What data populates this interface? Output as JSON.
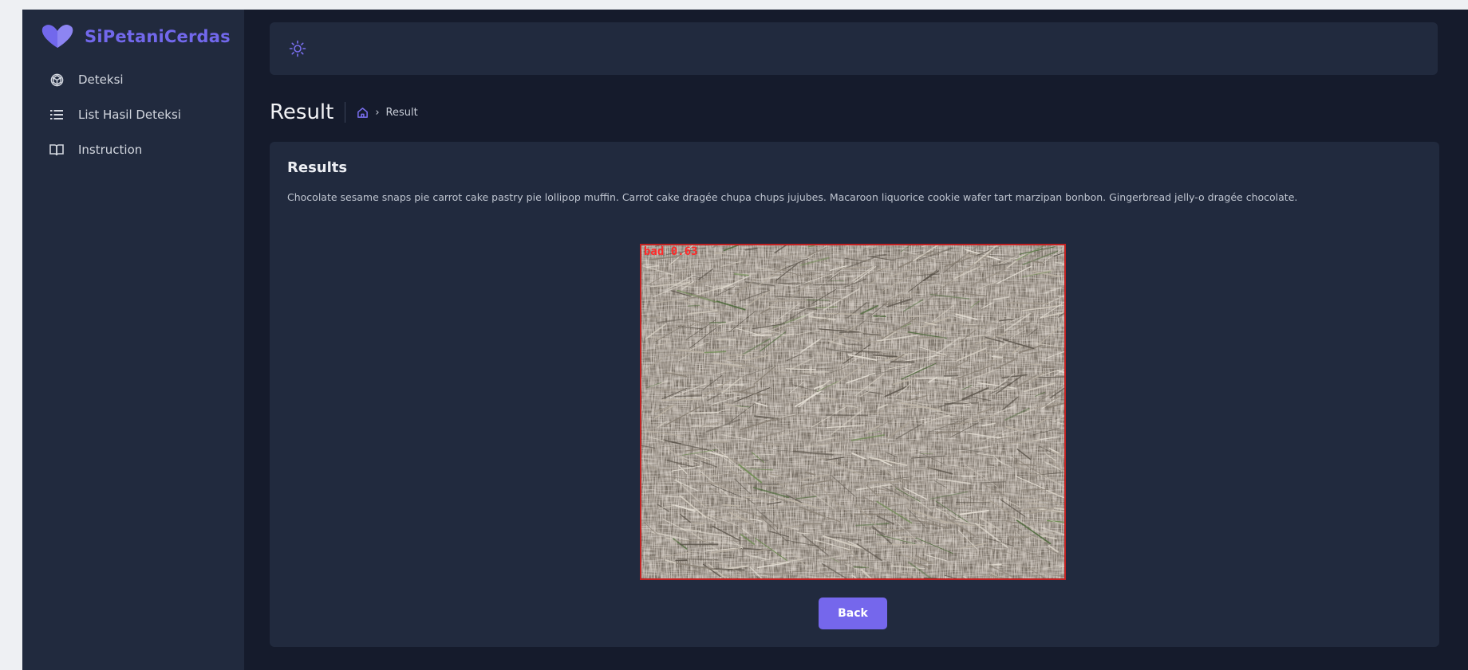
{
  "brand": {
    "name": "SiPetaniCerdas",
    "logo_icon": "heart-logo-icon",
    "color": "#7268ec"
  },
  "sidebar": {
    "items": [
      {
        "label": "Deteksi",
        "icon": "cube-icon"
      },
      {
        "label": "List Hasil Deteksi",
        "icon": "list-icon"
      },
      {
        "label": "Instruction",
        "icon": "book-icon"
      }
    ]
  },
  "topbar": {
    "theme_toggle_icon": "sun-icon"
  },
  "page": {
    "title": "Result",
    "breadcrumb": {
      "home_icon": "home-icon",
      "separator": "›",
      "current": "Result"
    }
  },
  "results": {
    "title": "Results",
    "description": "Chocolate sesame snaps pie carrot cake pastry pie lollipop muffin. Carrot cake dragée chupa chups jujubes. Macaroon liquorice cookie wafer tart marzipan bonbon. Gingerbread jelly-o dragée chocolate.",
    "detection": {
      "label": "bad 0.63",
      "box_color": "#c22222"
    },
    "back_label": "Back"
  },
  "colors": {
    "accent": "#7567ec",
    "background": "#151b2c",
    "panel": "#212a3e"
  }
}
